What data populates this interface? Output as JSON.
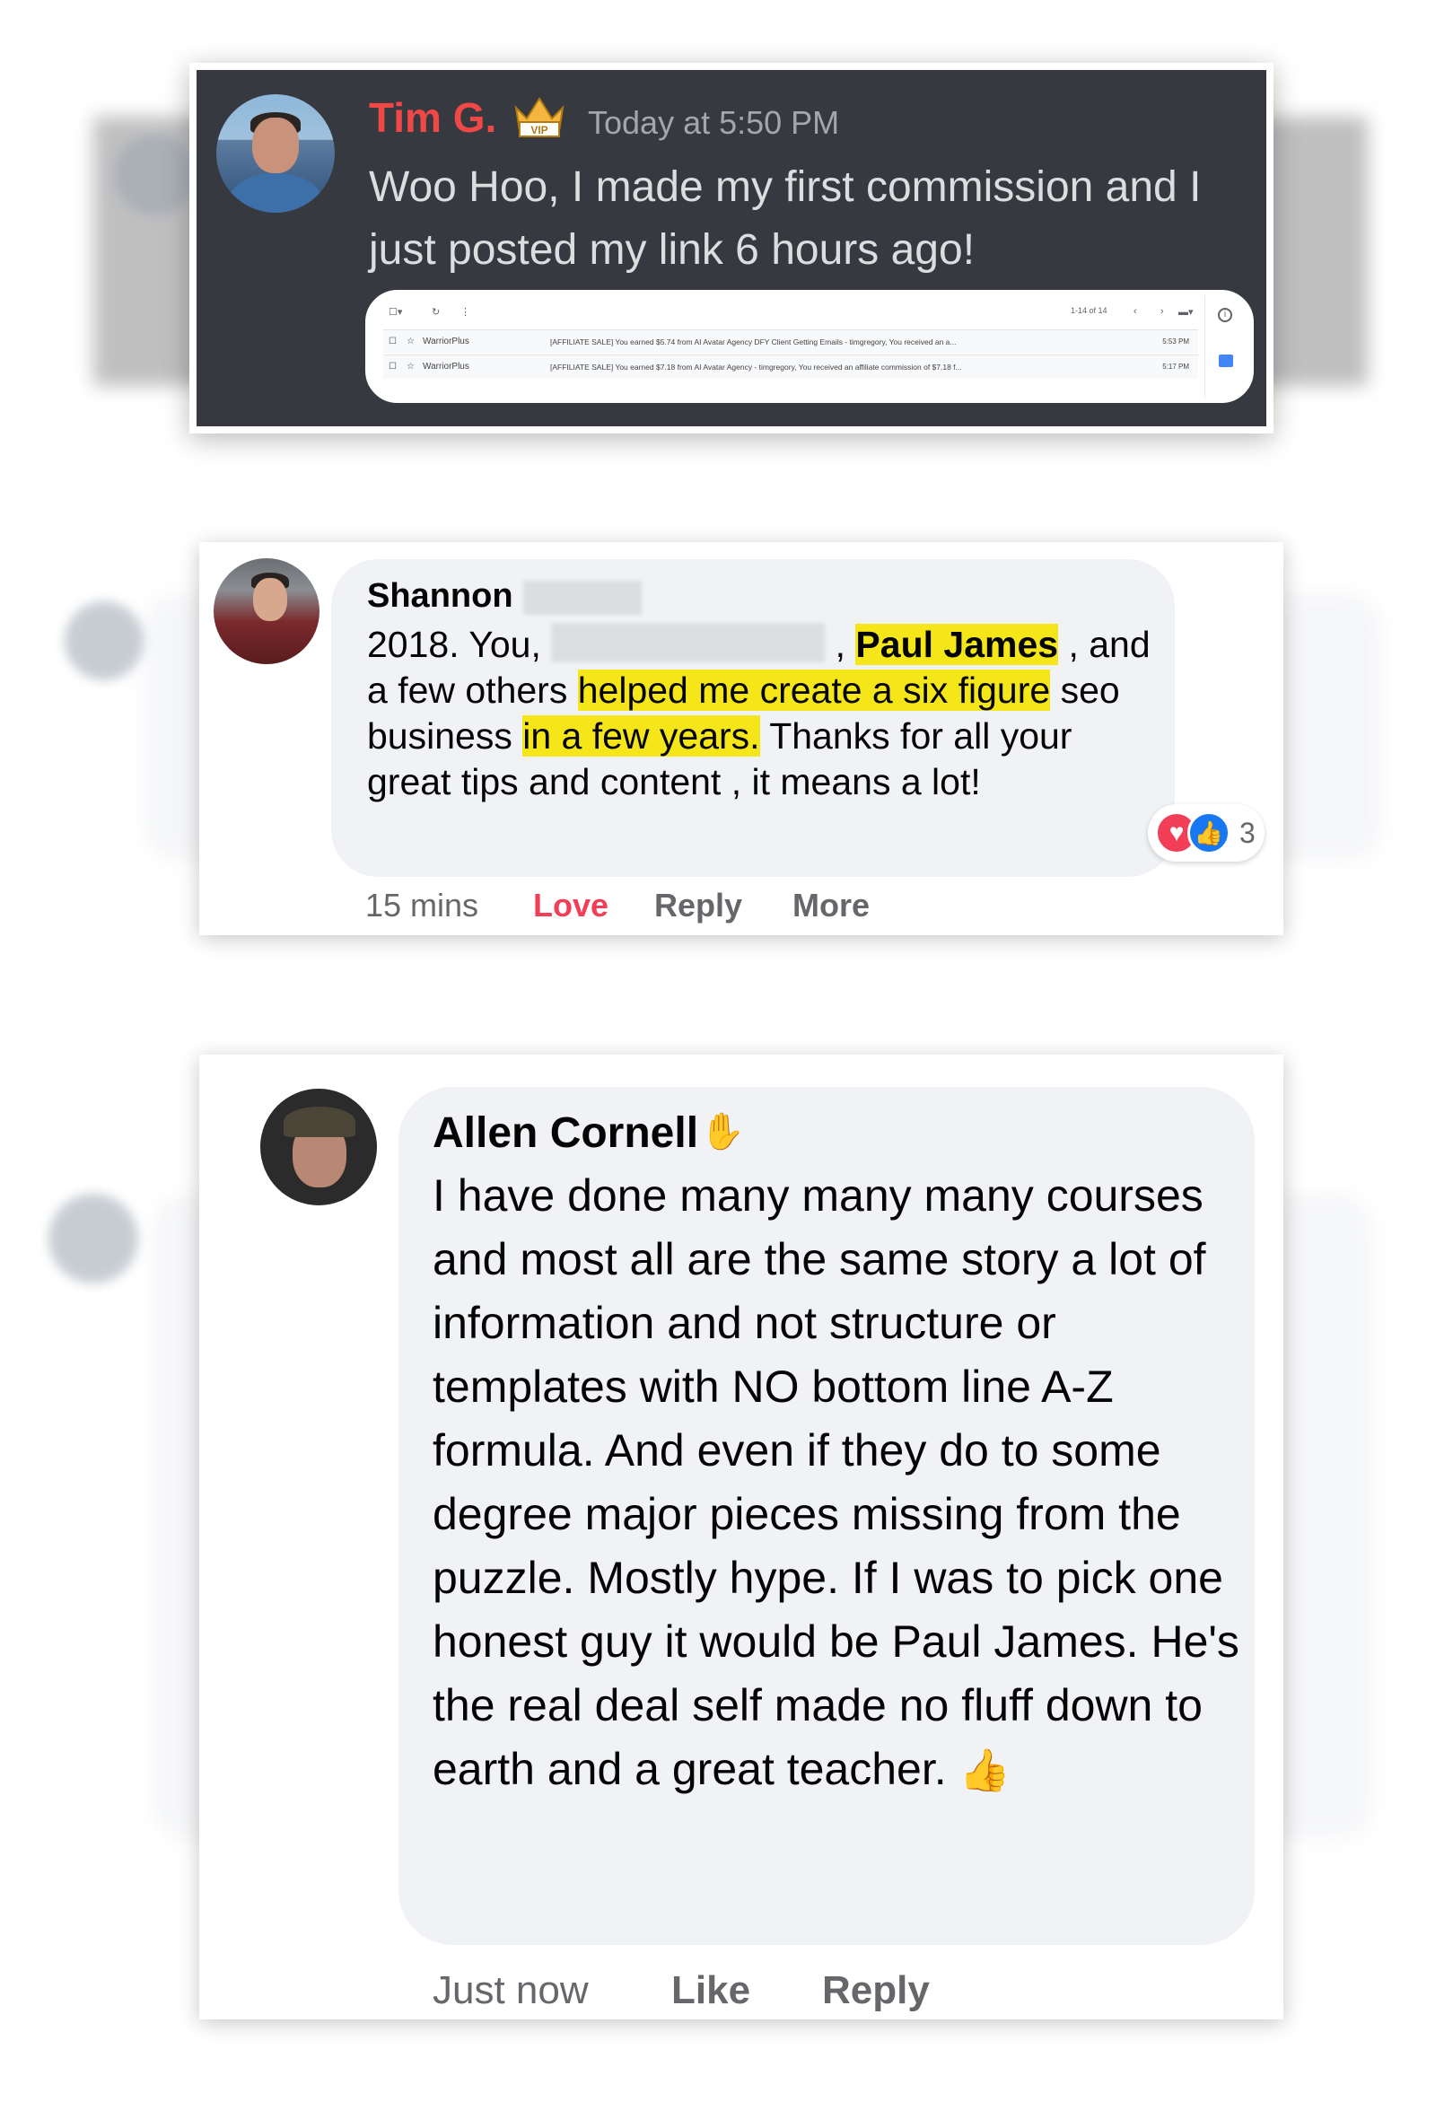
{
  "discord": {
    "author": "Tim G.",
    "badge_icon": "vip-crown-icon",
    "timestamp": "Today at 5:50 PM",
    "message": "Woo Hoo, I made my first commission and I just posted my link 6 hours ago!",
    "accent_color": "#f04747",
    "screenshot": {
      "pagination": "1-14 of 14",
      "rows": [
        {
          "sender": "WarriorPlus",
          "subject": "[AFFILIATE SALE] You earned $5.74 from AI Avatar Agency DFY Client Getting Emails - timgregory, You received an a...",
          "time": "5:53 PM"
        },
        {
          "sender": "WarriorPlus",
          "subject": "[AFFILIATE SALE] You earned $7.18 from AI Avatar Agency - timgregory, You received an affiliate commission of $7.18 f...",
          "time": "5:17 PM"
        }
      ]
    }
  },
  "comment_shannon": {
    "author": "Shannon",
    "text_parts": {
      "p1": "2018. You, ",
      "p2": " , ",
      "h1": "Paul James",
      "p3": " , and a few others ",
      "h2": "helped me create a six figure",
      "p4": " seo business ",
      "h3": "in a few years.",
      "p5": " Thanks for all your great tips and content , it means a lot!"
    },
    "reaction_count": "3",
    "actions": {
      "time": "15 mins",
      "love": "Love",
      "reply": "Reply",
      "more": "More"
    },
    "highlight_color": "#f5e61a",
    "love_color": "#f33e58"
  },
  "comment_allen": {
    "author": "Allen Cornell",
    "badge_icon": "waving-hand-icon",
    "text": "I have done many many many courses and most all are the same story a lot of information and not structure or templates with NO bottom line A-Z formula. And even if they do to some degree major pieces missing from the puzzle. Mostly hype. If I was to pick one honest guy it would be Paul James. He's the real deal self made no fluff down to earth and a great teacher.",
    "emoji": "👍",
    "actions": {
      "time": "Just now",
      "like": "Like",
      "reply": "Reply"
    }
  }
}
